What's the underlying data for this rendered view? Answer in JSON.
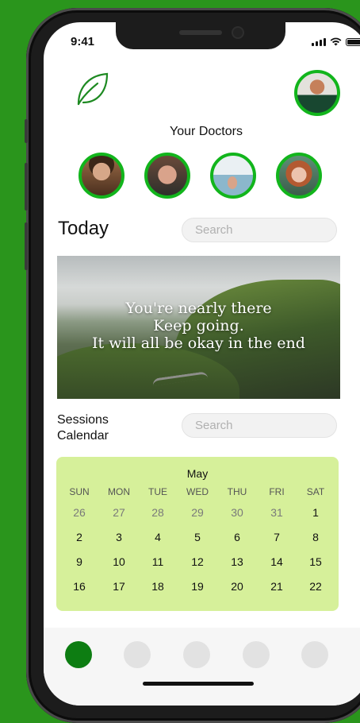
{
  "status_bar": {
    "time": "9:41"
  },
  "header": {
    "logo_icon": "leaf-icon",
    "profile_icon": "user-avatar"
  },
  "doctors": {
    "title": "Your Doctors",
    "avatars": [
      "doctor-1",
      "doctor-2",
      "doctor-3",
      "doctor-4"
    ]
  },
  "today": {
    "title": "Today",
    "search_placeholder": "Search"
  },
  "hero": {
    "lines": [
      "You're nearly there",
      "Keep going.",
      "It will all be okay in the end"
    ]
  },
  "sessions": {
    "title_line1": "Sessions",
    "title_line2": "Calendar",
    "search_placeholder": "Search"
  },
  "calendar": {
    "month": "May",
    "weekdays": [
      "SUN",
      "MON",
      "TUE",
      "WED",
      "THU",
      "FRI",
      "SAT"
    ],
    "weeks": [
      [
        {
          "d": "26",
          "muted": true
        },
        {
          "d": "27",
          "muted": true
        },
        {
          "d": "28",
          "muted": true
        },
        {
          "d": "29",
          "muted": true
        },
        {
          "d": "30",
          "muted": true
        },
        {
          "d": "31",
          "muted": true
        },
        {
          "d": "1",
          "muted": false
        }
      ],
      [
        {
          "d": "2",
          "muted": false
        },
        {
          "d": "3",
          "muted": false
        },
        {
          "d": "4",
          "muted": false
        },
        {
          "d": "5",
          "muted": false
        },
        {
          "d": "6",
          "muted": false
        },
        {
          "d": "7",
          "muted": false
        },
        {
          "d": "8",
          "muted": false
        }
      ],
      [
        {
          "d": "9",
          "muted": false
        },
        {
          "d": "10",
          "muted": false
        },
        {
          "d": "11",
          "muted": false
        },
        {
          "d": "12",
          "muted": false
        },
        {
          "d": "13",
          "muted": false
        },
        {
          "d": "14",
          "muted": false
        },
        {
          "d": "15",
          "muted": false
        }
      ],
      [
        {
          "d": "16",
          "muted": false
        },
        {
          "d": "17",
          "muted": false
        },
        {
          "d": "18",
          "muted": false
        },
        {
          "d": "19",
          "muted": false
        },
        {
          "d": "20",
          "muted": false
        },
        {
          "d": "21",
          "muted": false
        },
        {
          "d": "22",
          "muted": false
        }
      ]
    ]
  },
  "tab_bar": {
    "active_index": 0,
    "tab_count": 5
  },
  "colors": {
    "background": "#2a951c",
    "accent": "#12b51c",
    "active_tab": "#0d7d12",
    "calendar_bg": "#d6f09a"
  }
}
